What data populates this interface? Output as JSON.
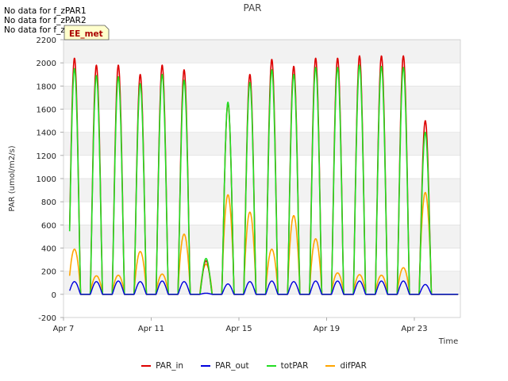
{
  "nodata_messages": [
    "No data for f_zPAR1",
    "No data for f_zPAR2",
    "No data for f_zPAR3"
  ],
  "badge": {
    "label": "EE_met",
    "bg": "#ffffcc",
    "color": "#aa0000"
  },
  "chart_data": {
    "type": "line",
    "title": "PAR",
    "xlabel": "Time",
    "ylabel": "PAR (umol/m2/s)",
    "x_start": "Apr 7",
    "x_end": "Apr 25",
    "xlim_days": [
      0,
      18.1
    ],
    "ylim": [
      -200,
      2200
    ],
    "yticks": [
      -200,
      0,
      200,
      400,
      600,
      800,
      1000,
      1200,
      1400,
      1600,
      1800,
      2000,
      2200
    ],
    "xticks": [
      {
        "day": 0,
        "label": "Apr 7"
      },
      {
        "day": 4,
        "label": "Apr 11"
      },
      {
        "day": 8,
        "label": "Apr 15"
      },
      {
        "day": 12,
        "label": "Apr 19"
      },
      {
        "day": 16,
        "label": "Apr 23"
      }
    ],
    "grid": true,
    "legend_position": "bottom",
    "series": [
      {
        "name": "PAR_in",
        "color": "#dd0000"
      },
      {
        "name": "PAR_out",
        "color": "#0000dd"
      },
      {
        "name": "totPAR",
        "color": "#22dd22"
      },
      {
        "name": "difPAR",
        "color": "#ffa500"
      }
    ],
    "daily_peaks": [
      {
        "day": 0,
        "PAR_in": 2040,
        "PAR_out": 110,
        "totPAR": 1950,
        "difPAR": 390
      },
      {
        "day": 1,
        "PAR_in": 1980,
        "PAR_out": 110,
        "totPAR": 1890,
        "difPAR": 160
      },
      {
        "day": 2,
        "PAR_in": 1980,
        "PAR_out": 115,
        "totPAR": 1880,
        "difPAR": 165
      },
      {
        "day": 3,
        "PAR_in": 1900,
        "PAR_out": 110,
        "totPAR": 1820,
        "difPAR": 370
      },
      {
        "day": 4,
        "PAR_in": 1980,
        "PAR_out": 115,
        "totPAR": 1900,
        "difPAR": 175
      },
      {
        "day": 5,
        "PAR_in": 1940,
        "PAR_out": 110,
        "totPAR": 1850,
        "difPAR": 520
      },
      {
        "day": 6,
        "PAR_in": 290,
        "PAR_out": 10,
        "totPAR": 310,
        "difPAR": 260
      },
      {
        "day": 7,
        "PAR_in": 1650,
        "PAR_out": 90,
        "totPAR": 1660,
        "difPAR": 860
      },
      {
        "day": 8,
        "PAR_in": 1900,
        "PAR_out": 110,
        "totPAR": 1830,
        "difPAR": 710
      },
      {
        "day": 9,
        "PAR_in": 2030,
        "PAR_out": 115,
        "totPAR": 1940,
        "difPAR": 390
      },
      {
        "day": 10,
        "PAR_in": 1970,
        "PAR_out": 110,
        "totPAR": 1900,
        "difPAR": 680
      },
      {
        "day": 11,
        "PAR_in": 2040,
        "PAR_out": 115,
        "totPAR": 1960,
        "difPAR": 480
      },
      {
        "day": 12,
        "PAR_in": 2040,
        "PAR_out": 115,
        "totPAR": 1960,
        "difPAR": 185
      },
      {
        "day": 13,
        "PAR_in": 2060,
        "PAR_out": 115,
        "totPAR": 1980,
        "difPAR": 170
      },
      {
        "day": 14,
        "PAR_in": 2060,
        "PAR_out": 115,
        "totPAR": 1970,
        "difPAR": 165
      },
      {
        "day": 15,
        "PAR_in": 2060,
        "PAR_out": 115,
        "totPAR": 1960,
        "difPAR": 230
      },
      {
        "day": 16,
        "PAR_in": 1500,
        "PAR_out": 85,
        "totPAR": 1400,
        "difPAR": 880
      }
    ]
  }
}
